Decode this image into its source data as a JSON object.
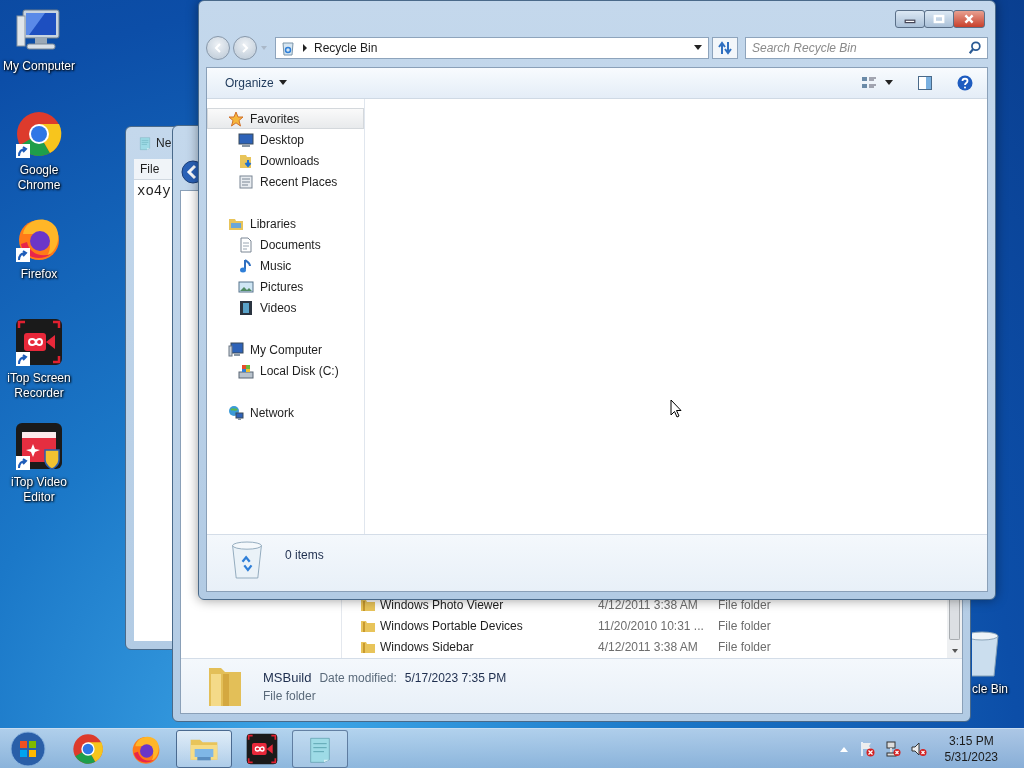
{
  "desktop_icons": [
    {
      "kind": "computer",
      "label": "My Computer"
    },
    {
      "kind": "chrome",
      "label": "Google Chrome"
    },
    {
      "kind": "firefox",
      "label": "Firefox"
    },
    {
      "kind": "recorder",
      "label": "iTop Screen Recorder"
    },
    {
      "kind": "editor",
      "label": "iTop Video Editor"
    }
  ],
  "recycle_bin_icon": {
    "label": "cle Bin"
  },
  "notepad": {
    "title": "Ne",
    "menu": "File",
    "text": "xo4y"
  },
  "back_explorer": {
    "files": [
      {
        "name": "Windows Photo Viewer",
        "date": "4/12/2011 3:38 AM",
        "type": "File folder"
      },
      {
        "name": "Windows Portable Devices",
        "date": "11/20/2010 10:31 ...",
        "type": "File folder"
      },
      {
        "name": "Windows Sidebar",
        "date": "4/12/2011 3:38 AM",
        "type": "File folder"
      }
    ],
    "details": {
      "name": "MSBuild",
      "date_label": "Date modified:",
      "date": "5/17/2023 7:35 PM",
      "type": "File folder"
    }
  },
  "explorer": {
    "address": "Recycle Bin",
    "search": {
      "placeholder": "Search Recycle Bin"
    },
    "organize": "Organize",
    "nav": [
      {
        "kind": "star",
        "label": "Favorites",
        "selected": true,
        "children": [
          {
            "kind": "desktop",
            "label": "Desktop",
            "selected": false
          },
          {
            "kind": "downloads",
            "label": "Downloads",
            "selected": false
          },
          {
            "kind": "recent",
            "label": "Recent Places",
            "selected": false
          }
        ]
      },
      {
        "kind": "library",
        "label": "Libraries",
        "selected": false,
        "children": [
          {
            "kind": "document",
            "label": "Documents",
            "selected": false
          },
          {
            "kind": "music",
            "label": "Music",
            "selected": false
          },
          {
            "kind": "pictures",
            "label": "Pictures",
            "selected": false
          },
          {
            "kind": "videos",
            "label": "Videos",
            "selected": false
          }
        ]
      },
      {
        "kind": "computer",
        "label": "My Computer",
        "selected": false,
        "children": [
          {
            "kind": "disk",
            "label": "Local Disk (C:)",
            "selected": false
          }
        ]
      },
      {
        "kind": "network",
        "label": "Network",
        "selected": false
      }
    ],
    "status": "0 items"
  },
  "taskbar": {
    "apps": [
      {
        "kind": "chrome",
        "running": false,
        "selected": false
      },
      {
        "kind": "firefox",
        "running": false,
        "selected": false
      },
      {
        "kind": "explorer",
        "running": true,
        "selected": true
      },
      {
        "kind": "recorder",
        "running": false,
        "selected": false
      },
      {
        "kind": "notepad",
        "running": true,
        "selected": false
      }
    ],
    "time": "3:15 PM",
    "date": "5/31/2023"
  }
}
